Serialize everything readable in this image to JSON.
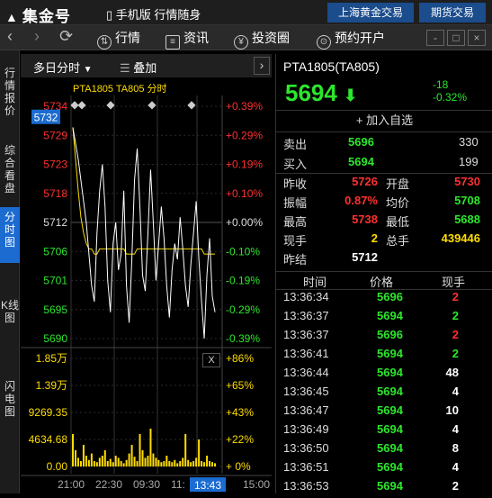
{
  "app": {
    "logo_text": "集金号",
    "mode_label": "手机版",
    "slogan": "行情随身",
    "tabs": [
      "上海黄金交易",
      "期货交易"
    ]
  },
  "toolbar": {
    "items": [
      {
        "label": "行情",
        "icon": "chart-icon"
      },
      {
        "label": "资讯",
        "icon": "news-icon"
      },
      {
        "label": "投资圈",
        "icon": "yen-icon"
      },
      {
        "label": "预约开户",
        "icon": "account-icon"
      }
    ],
    "window_buttons": [
      "-",
      "□",
      "×"
    ]
  },
  "rail": {
    "tabs": [
      "行情报价",
      "综合看盘",
      "分时图",
      "K线图",
      "闪电图"
    ],
    "active_index": 2
  },
  "chart_header": {
    "period": "多日分时",
    "overlay": "叠加",
    "next": "›"
  },
  "chart_data": {
    "type": "line",
    "title": "PTA1805 TA805 分时",
    "current_price_label": "5732",
    "price_ticks": [
      {
        "price": "5734",
        "pct": "+0.39%"
      },
      {
        "price": "5729",
        "pct": "+0.29%"
      },
      {
        "price": "5723",
        "pct": "+0.19%"
      },
      {
        "price": "5718",
        "pct": "+0.10%"
      },
      {
        "price": "5712",
        "pct": "+0.00%"
      },
      {
        "price": "5706",
        "pct": "-0.10%"
      },
      {
        "price": "5701",
        "pct": "-0.19%"
      },
      {
        "price": "5695",
        "pct": "-0.29%"
      },
      {
        "price": "5690",
        "pct": "-0.39%"
      }
    ],
    "volume_ticks": [
      {
        "vol": "1.85万",
        "pct": "+86%"
      },
      {
        "vol": "1.39万",
        "pct": "+65%"
      },
      {
        "vol": "9269.35",
        "pct": "+43%"
      },
      {
        "vol": "4634.68",
        "pct": "+22%"
      },
      {
        "vol": "0.00",
        "pct": "+ 0%"
      }
    ],
    "x_ticks": [
      "21:00",
      "22:30",
      "09:30",
      "11:",
      "13:43",
      "15:00"
    ],
    "close_label": "X",
    "ylim": [
      5690,
      5734
    ],
    "price_series": [
      5730,
      5727,
      5724,
      5720,
      5716,
      5712,
      5706,
      5700,
      5697,
      5710,
      5718,
      5723,
      5715,
      5701,
      5695,
      5708,
      5712,
      5703,
      5706,
      5718,
      5700,
      5693,
      5705,
      5720,
      5726,
      5715,
      5702,
      5699,
      5710,
      5722,
      5712,
      5701,
      5708,
      5715,
      5709,
      5700,
      5694,
      5703,
      5708,
      5705,
      5713,
      5707,
      5700,
      5696,
      5704,
      5710,
      5716,
      5705,
      5697,
      5690,
      5702,
      5709,
      5698,
      5695
    ],
    "avg_series": [
      5730,
      5724,
      5718,
      5713,
      5710,
      5708,
      5707,
      5707,
      5706,
      5706,
      5707,
      5707,
      5707,
      5707,
      5707,
      5707,
      5707,
      5707,
      5707,
      5707,
      5706,
      5706,
      5706,
      5706,
      5707,
      5707,
      5707,
      5707,
      5707,
      5707,
      5707,
      5707,
      5707,
      5707,
      5707,
      5707,
      5707,
      5707,
      5707,
      5707,
      5707,
      5707,
      5707,
      5707,
      5707,
      5707,
      5707,
      5707,
      5707,
      5706,
      5706,
      5706,
      5706,
      5706
    ],
    "volume_series": [
      0.3,
      0.15,
      0.08,
      0.05,
      0.2,
      0.1,
      0.06,
      0.12,
      0.05,
      0.04,
      0.08,
      0.1,
      0.15,
      0.05,
      0.07,
      0.04,
      0.1,
      0.08,
      0.05,
      0.03,
      0.06,
      0.12,
      0.2,
      0.09,
      0.05,
      0.3,
      0.15,
      0.08,
      0.1,
      0.35,
      0.12,
      0.08,
      0.06,
      0.04,
      0.05,
      0.1,
      0.05,
      0.04,
      0.06,
      0.03,
      0.05,
      0.08,
      0.3,
      0.06,
      0.04,
      0.05,
      0.08,
      0.25,
      0.05,
      0.04,
      0.1,
      0.05,
      0.04,
      0.03
    ]
  },
  "quote": {
    "name": "PTA1805(TA805)",
    "price": "5694",
    "arrow": "⬇",
    "change": "-18",
    "change_pct": "-0.32%",
    "add_watch": "+ 加入自选",
    "sell": {
      "label": "卖出",
      "price": "5696",
      "vol": "330"
    },
    "buy": {
      "label": "买入",
      "price": "5694",
      "vol": "199"
    },
    "stats": [
      {
        "l1": "昨收",
        "v1": "5726",
        "c1": "r",
        "l2": "开盘",
        "v2": "5730",
        "c2": "r"
      },
      {
        "l1": "振幅",
        "v1": "0.87%",
        "c1": "r",
        "l2": "均价",
        "v2": "5708",
        "c2": "g"
      },
      {
        "l1": "最高",
        "v1": "5738",
        "c1": "r",
        "l2": "最低",
        "v2": "5688",
        "c2": "g"
      },
      {
        "l1": "现手",
        "v1": "2",
        "c1": "y",
        "l2": "总手",
        "v2": "439446",
        "c2": "y"
      },
      {
        "l1": "昨结",
        "v1": "5712",
        "c1": "w",
        "l2": "",
        "v2": "",
        "c2": "w"
      }
    ]
  },
  "trades": {
    "headers": [
      "时间",
      "价格",
      "现手"
    ],
    "rows": [
      {
        "time": "13:36:34",
        "price": "5696",
        "vol": "2",
        "vc": "r"
      },
      {
        "time": "13:36:37",
        "price": "5694",
        "vol": "2",
        "vc": "g"
      },
      {
        "time": "13:36:37",
        "price": "5696",
        "vol": "2",
        "vc": "r"
      },
      {
        "time": "13:36:41",
        "price": "5694",
        "vol": "2",
        "vc": "g"
      },
      {
        "time": "13:36:44",
        "price": "5694",
        "vol": "48",
        "vc": "w"
      },
      {
        "time": "13:36:45",
        "price": "5694",
        "vol": "4",
        "vc": "w"
      },
      {
        "time": "13:36:47",
        "price": "5694",
        "vol": "10",
        "vc": "w"
      },
      {
        "time": "13:36:49",
        "price": "5694",
        "vol": "4",
        "vc": "w"
      },
      {
        "time": "13:36:50",
        "price": "5694",
        "vol": "8",
        "vc": "w"
      },
      {
        "time": "13:36:51",
        "price": "5694",
        "vol": "4",
        "vc": "w"
      },
      {
        "time": "13:36:53",
        "price": "5694",
        "vol": "2",
        "vc": "w"
      }
    ]
  }
}
